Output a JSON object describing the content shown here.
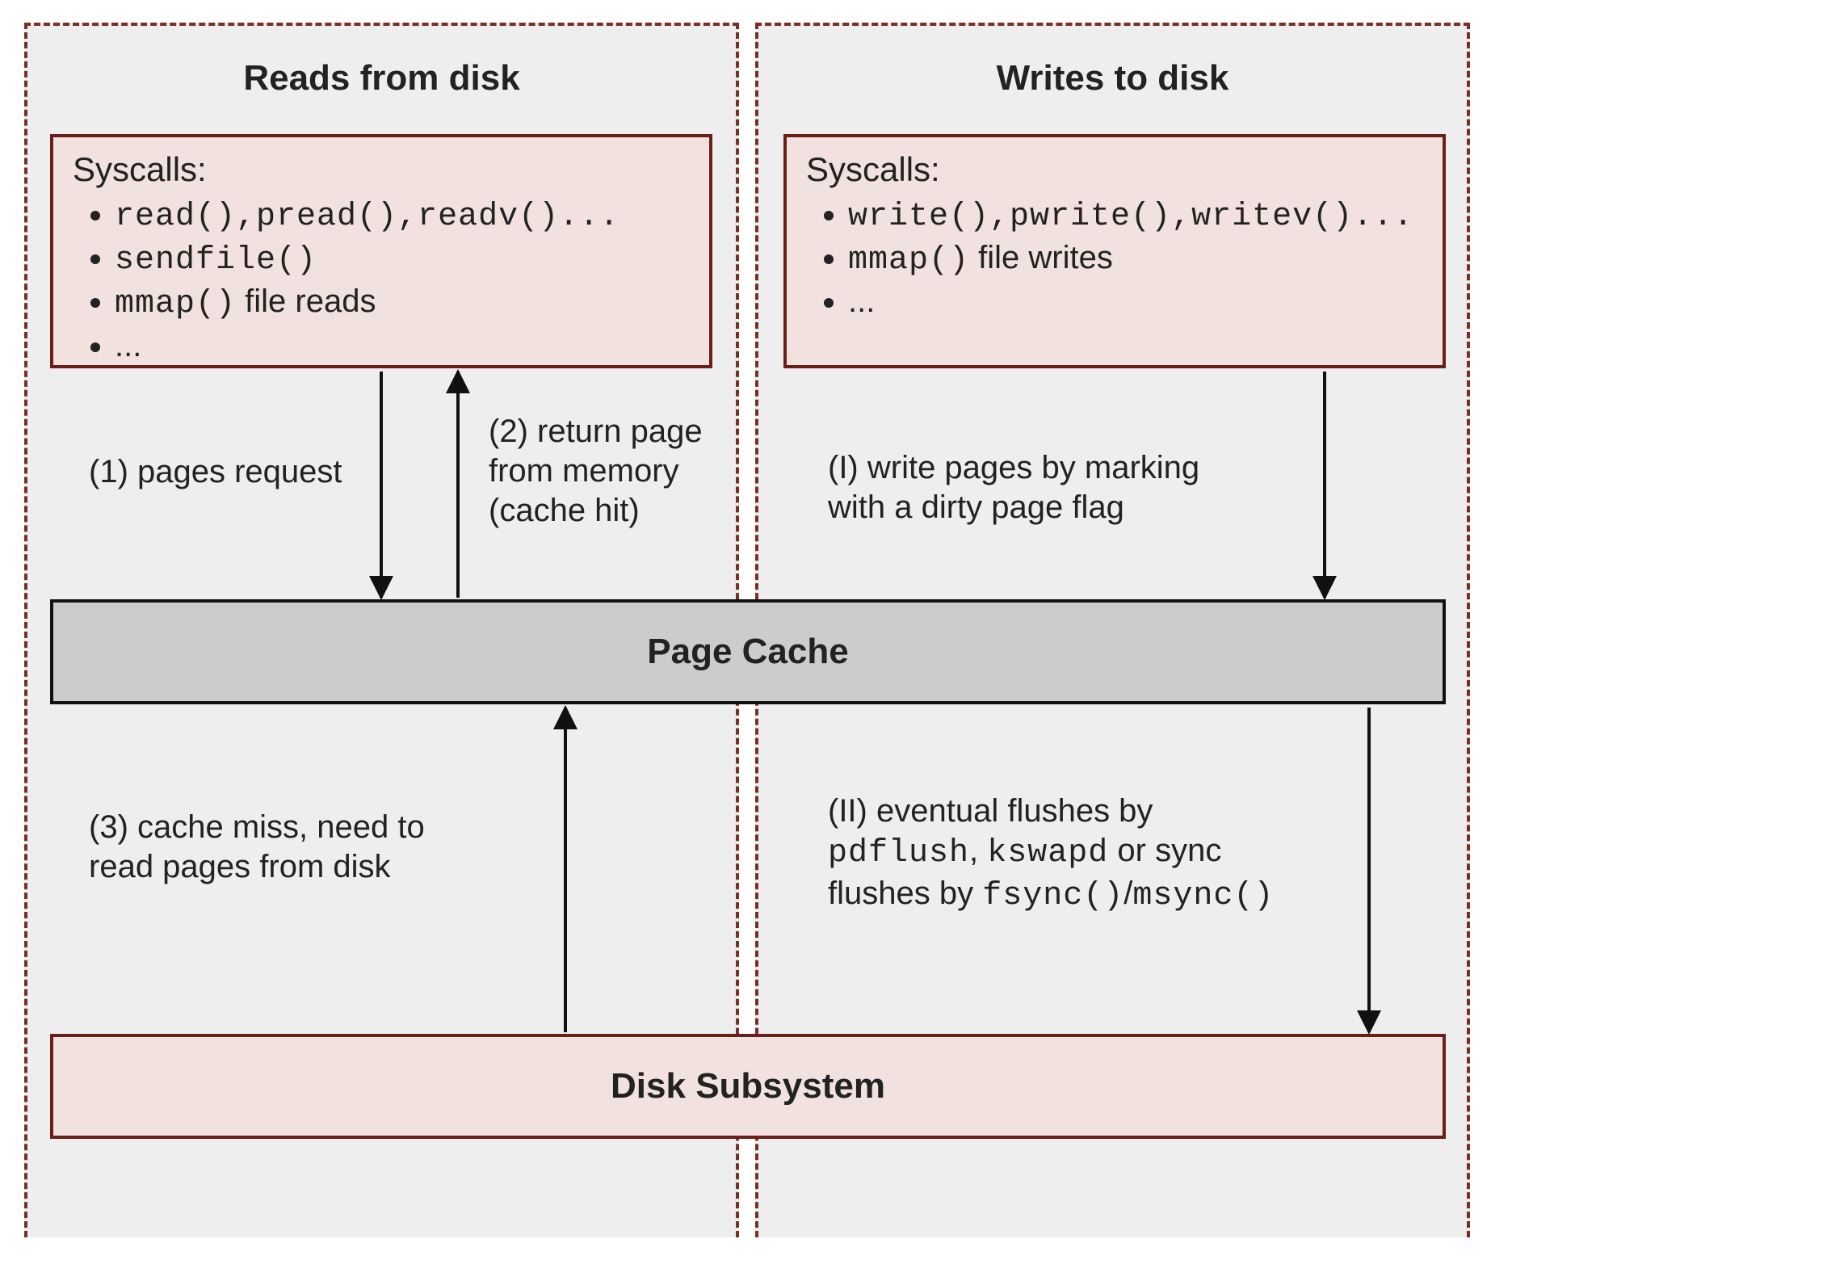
{
  "columns": {
    "left_title": "Reads from disk",
    "right_title": "Writes to disk"
  },
  "syscalls_read": {
    "heading": "Syscalls:",
    "items": {
      "i1": "read(),pread(),readv()...",
      "i2": "sendfile()",
      "i3_code": "mmap()",
      "i3_tail": " file reads",
      "i4": "..."
    }
  },
  "syscalls_write": {
    "heading": "Syscalls:",
    "items": {
      "i1": "write(),pwrite(),writev()...",
      "i2_code": "mmap()",
      "i2_tail": " file writes",
      "i3": "..."
    }
  },
  "page_cache": "Page Cache",
  "disk_subsystem": "Disk Subsystem",
  "annotations": {
    "a1": "(1) pages request",
    "a2": "(2) return page\nfrom memory\n(cache hit)",
    "a3": "(3) cache miss, need to\nread pages from disk",
    "aI": "(I) write pages by marking\nwith a dirty page flag",
    "aII_pre": "(II) eventual flushes by\n",
    "aII_c1": "pdflush",
    "aII_mid1": ", ",
    "aII_c2": "kswapd",
    "aII_mid2": " or sync\nflushes by ",
    "aII_c3": "fsync()",
    "aII_slash": "/",
    "aII_c4": "msync()"
  }
}
